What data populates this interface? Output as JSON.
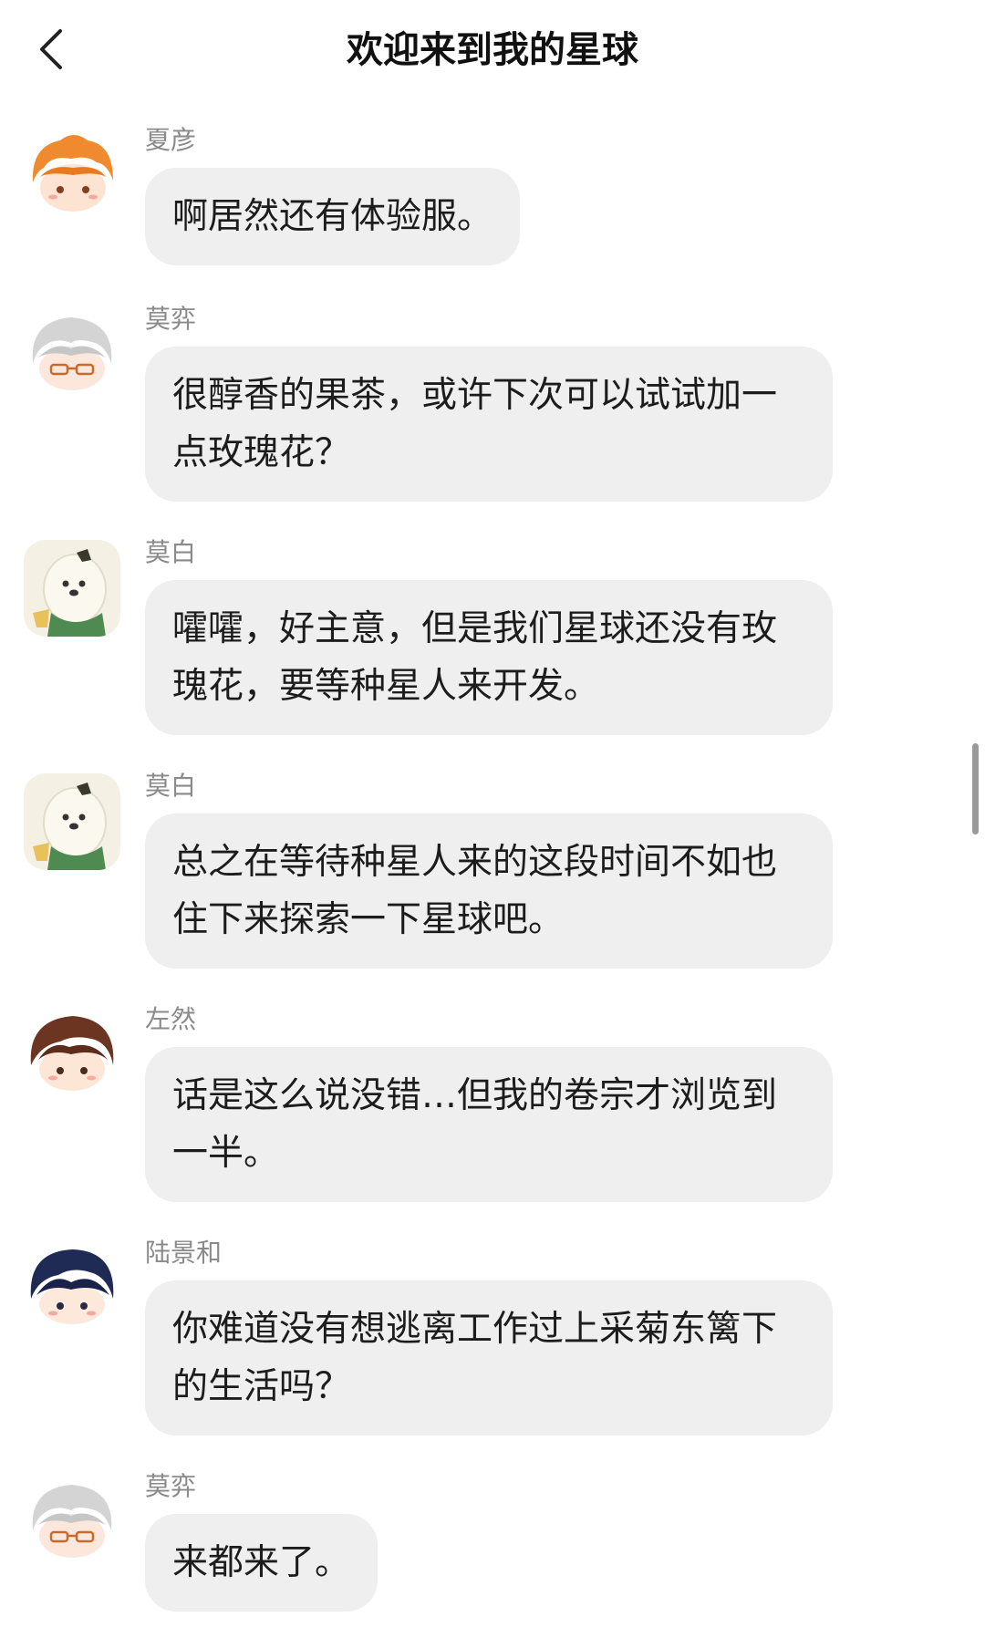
{
  "header": {
    "title": "欢迎来到我的星球"
  },
  "messages": [
    {
      "name": "夏彦",
      "avatar": "xiayan-avatar",
      "text": "啊居然还有体验服。"
    },
    {
      "name": "莫弈",
      "avatar": "moyi-avatar",
      "text": "很醇香的果茶，或许下次可以试试加一点玫瑰花？"
    },
    {
      "name": "莫白",
      "avatar": "mobai-avatar",
      "text": "嚯嚯，好主意，但是我们星球还没有玫瑰花，要等种星人来开发。"
    },
    {
      "name": "莫白",
      "avatar": "mobai-avatar",
      "text": "总之在等待种星人来的这段时间不如也住下来探索一下星球吧。"
    },
    {
      "name": "左然",
      "avatar": "zuoran-avatar",
      "text": "话是这么说没错…但我的卷宗才浏览到一半。"
    },
    {
      "name": "陆景和",
      "avatar": "lujinghe-avatar",
      "text": "你难道没有想逃离工作过上采菊东篱下的生活吗？"
    },
    {
      "name": "莫弈",
      "avatar": "moyi-avatar",
      "text": "来都来了。"
    }
  ],
  "colors": {
    "bubble": "#efefef",
    "name": "#8a8a8a",
    "background": "#ffffff"
  }
}
